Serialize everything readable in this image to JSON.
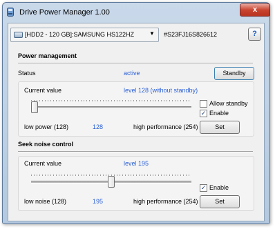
{
  "window": {
    "title": "Drive Power Manager 1.00",
    "close_glyph": "x"
  },
  "drive": {
    "selected": "[HDD2 - 120 GB]:SAMSUNG HS122HZ",
    "serial": "#S23FJ16S826612",
    "help_label": "?"
  },
  "power": {
    "heading": "Power management",
    "status_label": "Status",
    "status_value": "active",
    "standby_button": "Standby",
    "current_label": "Current value",
    "current_value": "level 128 (without standby)",
    "allow_standby_label": "Allow standby",
    "allow_standby_checked": false,
    "enable_label": "Enable",
    "enable_checked": true,
    "low_label": "low power (128)",
    "slider_value": "128",
    "slider_level": 0.0,
    "high_label": "high performance (254)",
    "set_button": "Set"
  },
  "noise": {
    "heading": "Seek noise control",
    "current_label": "Current value",
    "current_value": "level 195",
    "enable_label": "Enable",
    "enable_checked": true,
    "low_label": "low noise (128)",
    "slider_value": "195",
    "slider_level": 0.5,
    "high_label": "high performance (254)",
    "set_button": "Set"
  },
  "colors": {
    "accent_text": "#2a5fd6",
    "close": "#c8442f"
  },
  "check_glyph": "✓"
}
